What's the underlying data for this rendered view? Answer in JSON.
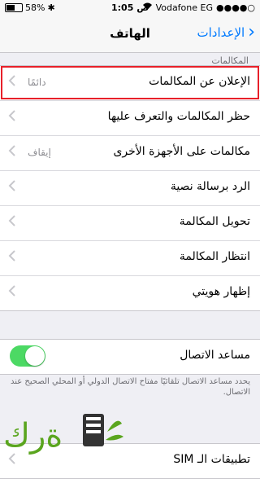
{
  "status_bar": {
    "battery": "58%",
    "carrier": "Vodafone EG",
    "time": "1:05",
    "ampm": "ص"
  },
  "navbar": {
    "title": "الهاتف",
    "back_label": "الإعدادات"
  },
  "section_header": "المكالمات",
  "calls_group": [
    {
      "label": "الإعلان عن المكالمات",
      "value": "دائمًا"
    },
    {
      "label": "حظر المكالمات والتعرف عليها",
      "value": ""
    },
    {
      "label": "مكالمات على الأجهزة الأخرى",
      "value": "إيقاف"
    },
    {
      "label": "الرد برسالة نصية",
      "value": ""
    },
    {
      "label": "تحويل المكالمة",
      "value": ""
    },
    {
      "label": "انتظار المكالمة",
      "value": ""
    },
    {
      "label": "إظهار هويتي",
      "value": ""
    }
  ],
  "dial_assist": {
    "label": "مساعد الاتصال",
    "enabled": true,
    "footer": "يحدد مساعد الاتصال تلقائيًا مفتاح الاتصال الدولي أو المحلي الصحيح عند الاتصال."
  },
  "sim_row": {
    "label": "تطبيقات الـ SIM"
  },
  "watermark": {
    "text": "فكرة"
  },
  "colors": {
    "accent": "#007aff",
    "highlight": "#e8202a",
    "toggle_on": "#4cd964",
    "watermark": "#5aa51e"
  }
}
